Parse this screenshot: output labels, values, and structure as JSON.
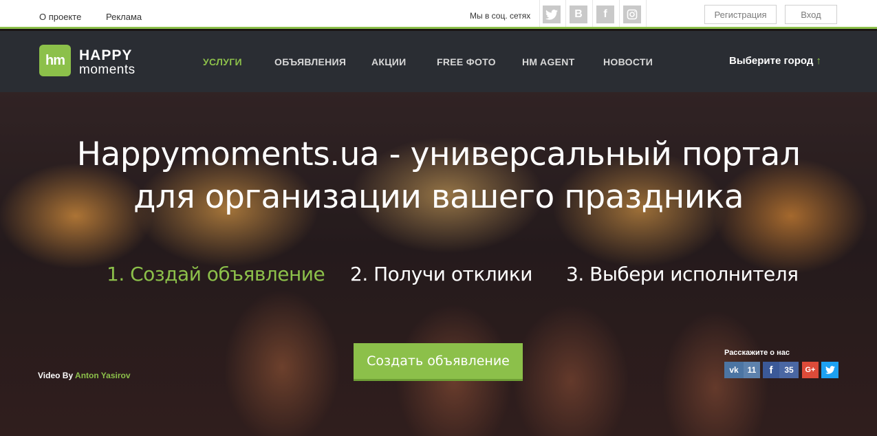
{
  "topbar": {
    "about": "О проекте",
    "ads": "Реклама",
    "social_label": "Мы в соц. сетях",
    "social_icons": [
      "twitter-icon",
      "vk-icon",
      "facebook-icon",
      "instagram-icon"
    ],
    "register": "Регистрация",
    "login": "Вход"
  },
  "logo": {
    "mark": "hm",
    "happy": "HAPPY",
    "moments": "moments"
  },
  "nav": {
    "items": [
      "УСЛУГИ",
      "ОБЪЯВЛЕНИЯ",
      "АКЦИИ",
      "FREE ФОТО",
      "HM AGENT",
      "НОВОСТИ"
    ],
    "active": "УСЛУГИ",
    "city": "Выберите город",
    "city_arrow": "↑"
  },
  "hero": {
    "title": "Happymoments.ua - универсальный портал для организации вашего праздника",
    "steps": [
      "1. Создай объявление",
      "2. Получи отклики",
      "3. Выбери исполнителя"
    ],
    "cta": "Создать объявление",
    "video_by": "Video By",
    "video_author": "Anton Yasirov"
  },
  "share": {
    "label": "Расскажите о нас",
    "vk_count": "11",
    "fb_count": "35"
  },
  "colors": {
    "accent": "#8cc04a",
    "nav_bg": "#2a2d33",
    "vk": "#4c75a3",
    "fb": "#3b5998",
    "gplus": "#dd4b39",
    "twitter": "#1da1f2"
  }
}
